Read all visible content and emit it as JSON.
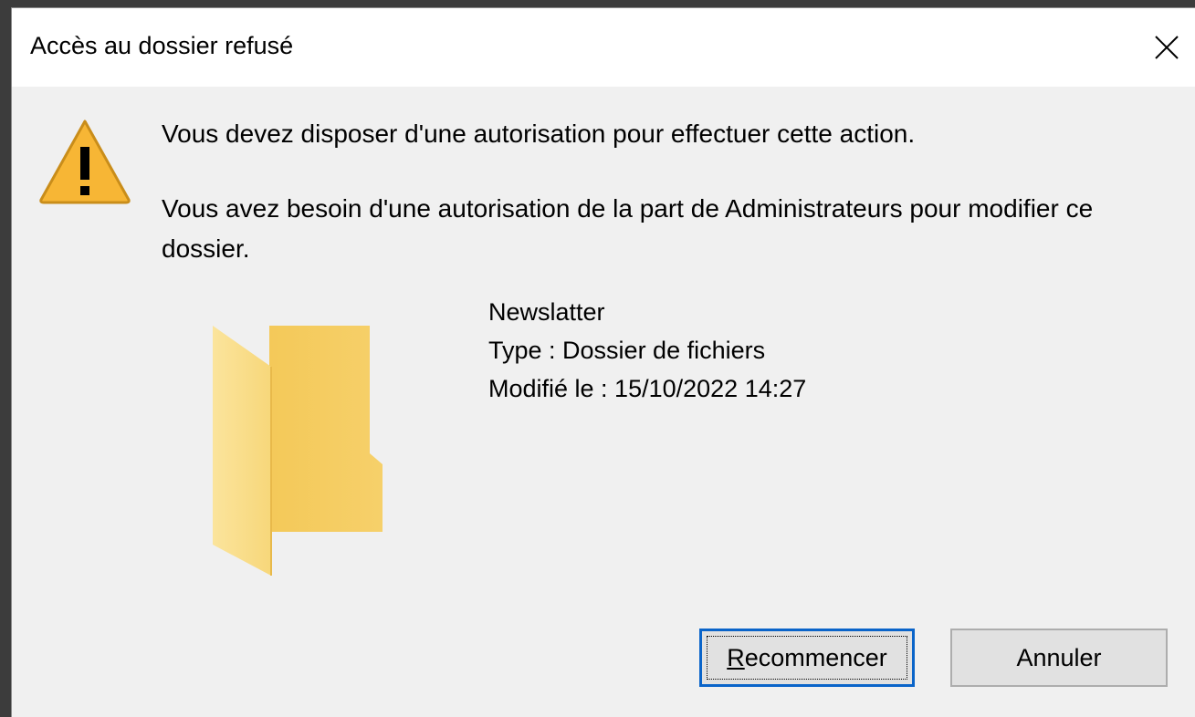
{
  "dialog": {
    "title": "Accès au dossier refusé",
    "close_icon": "close-icon",
    "warning_icon": "warning-icon",
    "folder_icon": "folder-icon",
    "message_line1": "Vous devez disposer d'une autorisation pour effectuer cette action.",
    "message_line2": "Vous avez besoin d'une autorisation de la part de Administrateurs pour modifier ce dossier.",
    "item": {
      "name": "Newslatter",
      "type": "Type : Dossier de fichiers",
      "modified": "Modifié le : 15/10/2022 14:27"
    },
    "buttons": {
      "retry_label": "Recommencer",
      "cancel_label": "Annuler"
    },
    "colors": {
      "warning_fill": "#f7b635",
      "folder_fill": "#f8d775",
      "focus_border": "#0a64c9"
    }
  }
}
